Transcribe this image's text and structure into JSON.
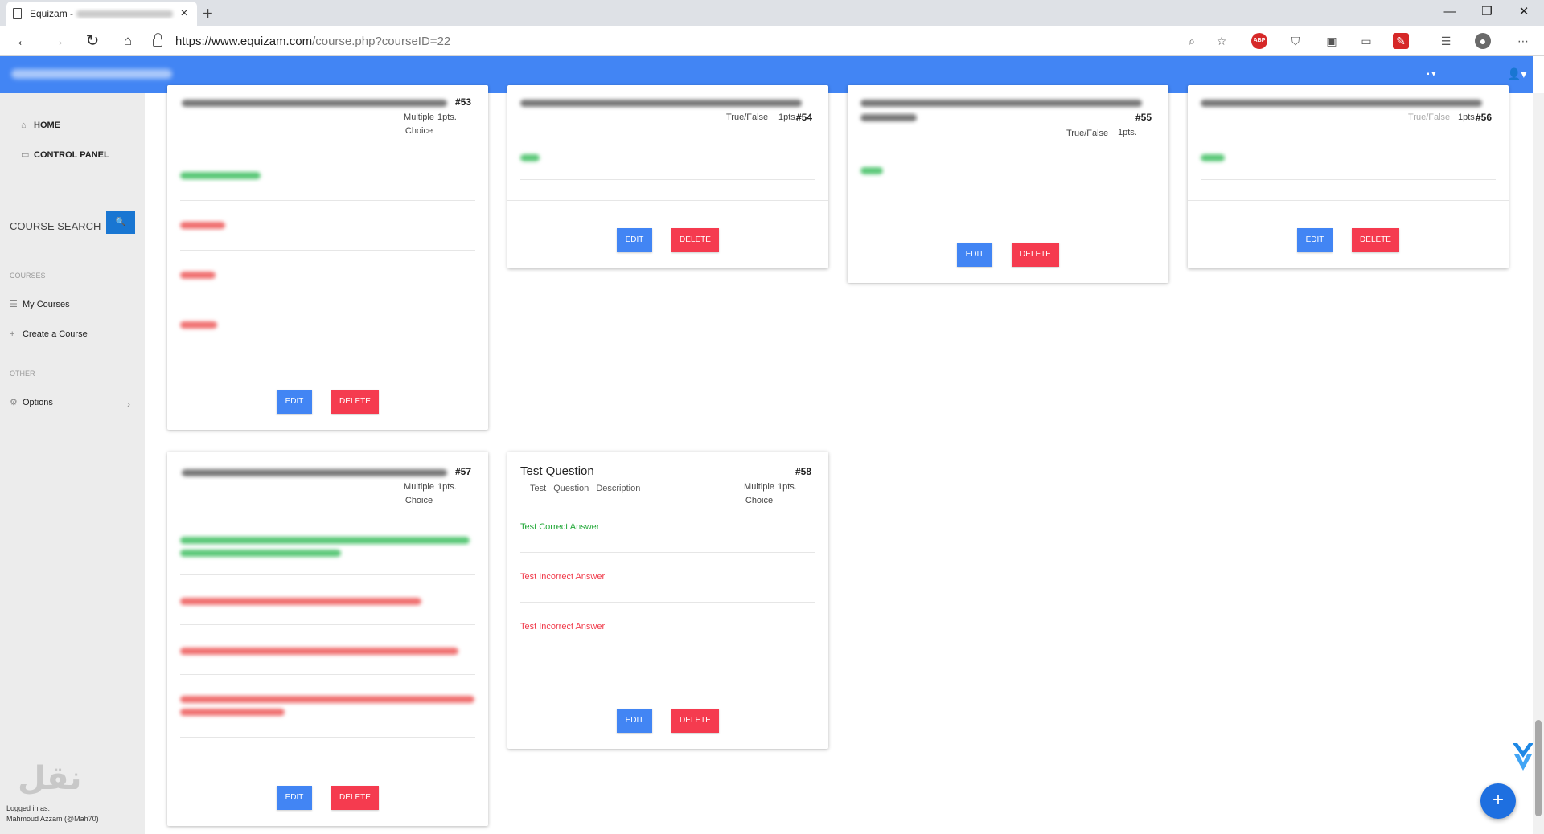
{
  "browser": {
    "tab_title": "Equizam -",
    "url_host": "https://www.equizam.com",
    "url_path": "/course.php?courseID=22"
  },
  "sidebar": {
    "home": "HOME",
    "control_panel": "CONTROL PANEL",
    "course_search": "COURSE SEARCH",
    "section_courses": "COURSES",
    "my_courses": "My Courses",
    "create_course": "Create a Course",
    "section_other": "OTHER",
    "options": "Options",
    "logged_in": "Logged in as:",
    "user_name": "Mahmoud Azzam (@Mah70)"
  },
  "buttons": {
    "edit": "EDIT",
    "delete": "DELETE"
  },
  "questions": {
    "q53": {
      "num": "#53",
      "type": "Multiple Choice",
      "pts": "1pts."
    },
    "q54": {
      "num": "#54",
      "type": "True/False",
      "pts": "1pts."
    },
    "q55": {
      "num": "#55",
      "type": "True/False",
      "pts": "1pts."
    },
    "q56": {
      "num": "#56",
      "type": "True/False",
      "pts": "1pts."
    },
    "q57": {
      "num": "#57",
      "type": "Multiple Choice",
      "pts": "1pts."
    },
    "q58": {
      "num": "#58",
      "title": "Test Question",
      "description": "Test Question Description",
      "type": "Multiple Choice",
      "pts": "1pts.",
      "answers": [
        "Test Correct Answer",
        "Test Incorrect Answer",
        "Test Incorrect Answer"
      ]
    }
  },
  "colors": {
    "primary": "#4285f4",
    "danger": "#f53b4f",
    "correct": "#22a838",
    "incorrect": "#f03a4a"
  }
}
